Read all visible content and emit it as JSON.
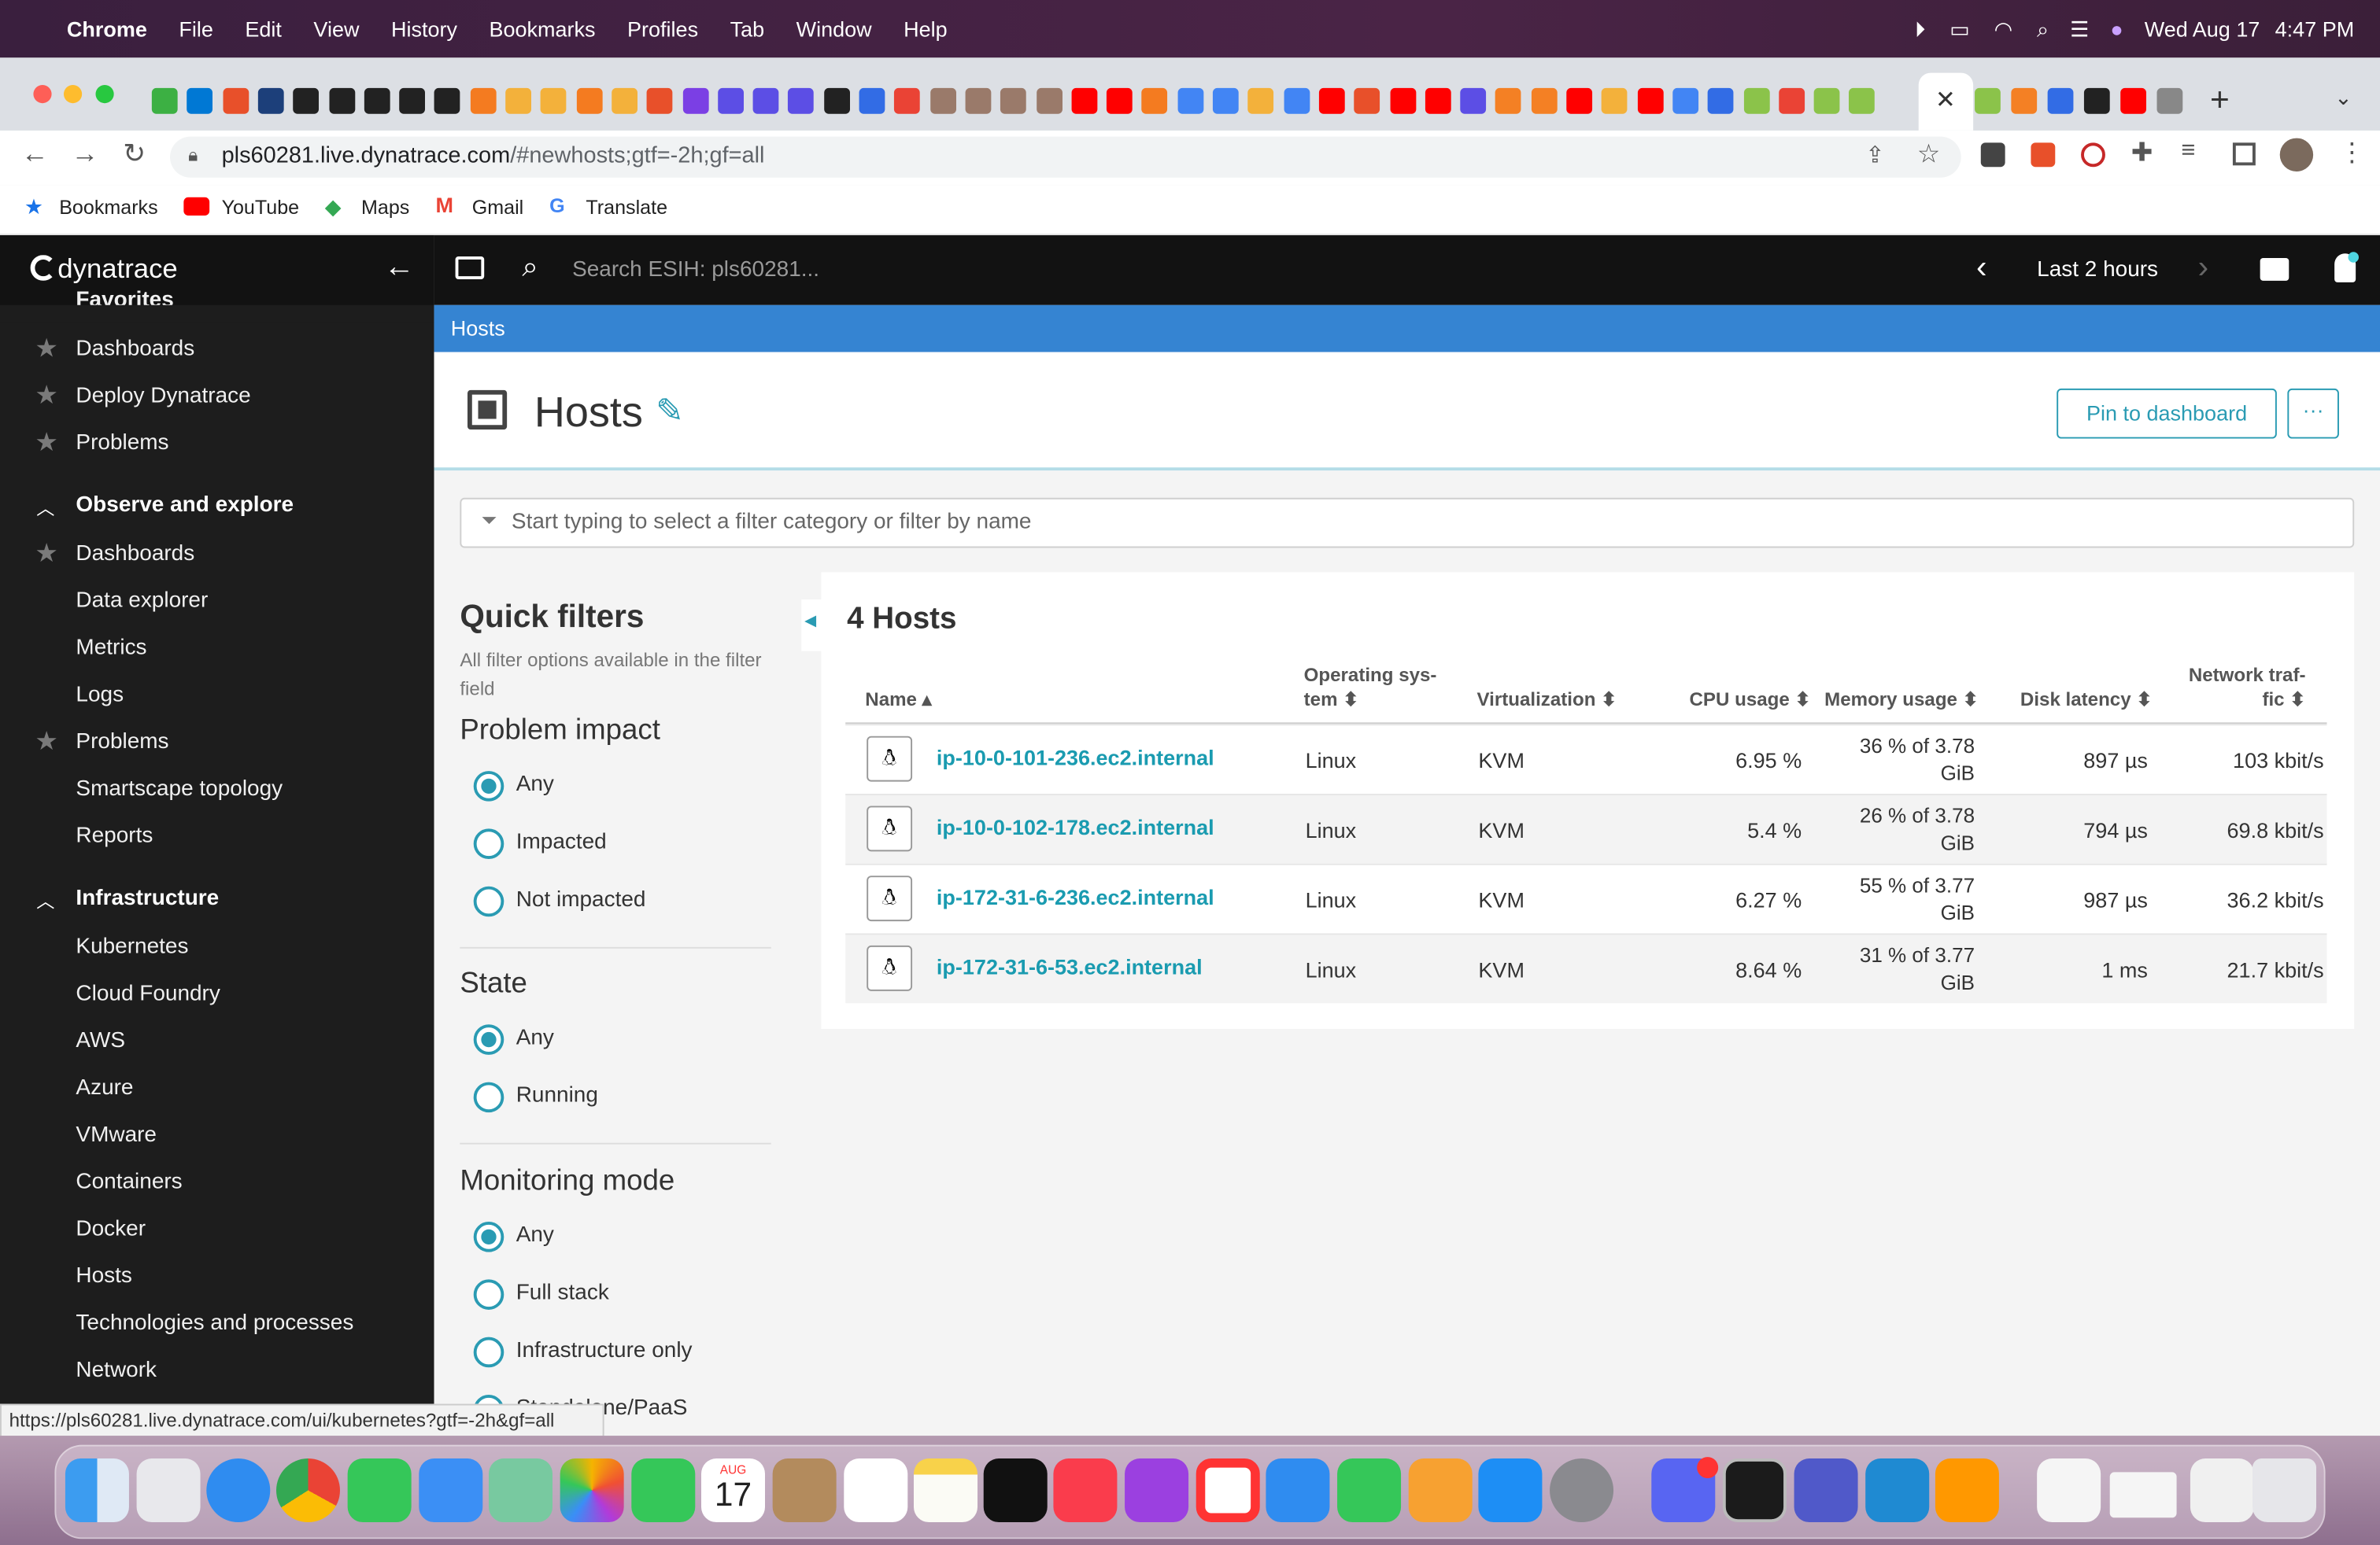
{
  "menubar": {
    "app": "Chrome",
    "items": [
      "File",
      "Edit",
      "View",
      "History",
      "Bookmarks",
      "Profiles",
      "Tab",
      "Window",
      "Help"
    ],
    "date": "Wed Aug 17",
    "time": "4:47 PM"
  },
  "browser": {
    "url_host": "pls60281.live.dynatrace.com",
    "url_path": "/#newhosts;gtf=-2h;gf=all",
    "bookmarks": [
      "Bookmarks",
      "YouTube",
      "Maps",
      "Gmail",
      "Translate"
    ],
    "status_url": "https://pls60281.live.dynatrace.com/ui/kubernetes?gtf=-2h&gf=all"
  },
  "dynatrace": {
    "logo_text": "dynatrace",
    "search_placeholder": "Search ESIH: pls60281...",
    "timeframe": "Last 2 hours",
    "breadcrumb": "Hosts",
    "page_title": "Hosts",
    "pin_label": "Pin to dashboard",
    "more_label": "···",
    "filter_placeholder": "Start typing to select a filter category or filter by name"
  },
  "sidebar": {
    "cut_top": "Favorites",
    "favorites": [
      "Dashboards",
      "Deploy Dynatrace",
      "Problems"
    ],
    "observe_title": "Observe and explore",
    "observe": [
      "Dashboards",
      "Data explorer",
      "Metrics",
      "Logs",
      "Problems",
      "Smartscape topology",
      "Reports"
    ],
    "infra_title": "Infrastructure",
    "infra": [
      "Kubernetes",
      "Cloud Foundry",
      "AWS",
      "Azure",
      "VMware",
      "Containers",
      "Docker",
      "Hosts",
      "Technologies and processes",
      "Network"
    ]
  },
  "quickfilters": {
    "title": "Quick filters",
    "subtitle": "All filter options available in the filter field",
    "problem_title": "Problem impact",
    "problem_options": [
      "Any",
      "Impacted",
      "Not impacted"
    ],
    "state_title": "State",
    "state_options": [
      "Any",
      "Running"
    ],
    "mode_title": "Monitoring mode",
    "mode_options": [
      "Any",
      "Full stack",
      "Infrastructure only",
      "Standalone/PaaS"
    ]
  },
  "hosts_table": {
    "title": "4 Hosts",
    "headers": {
      "name": "Name ▴",
      "os": "Operating sys-\ntem ⬍",
      "virt": "Virtualization ⬍",
      "cpu": "CPU usage ⬍",
      "mem": "Memory usage ⬍",
      "disk": "Disk latency ⬍",
      "net": "Network traf-\nfic ⬍"
    },
    "rows": [
      {
        "name": "ip-10-0-101-236.ec2.internal",
        "os": "Linux",
        "virt": "KVM",
        "cpu": "6.95 %",
        "mem1": "36 % of 3.78",
        "mem2": "GiB",
        "disk": "897 µs",
        "net": "103 kbit/s"
      },
      {
        "name": "ip-10-0-102-178.ec2.internal",
        "os": "Linux",
        "virt": "KVM",
        "cpu": "5.4 %",
        "mem1": "26 % of 3.78",
        "mem2": "GiB",
        "disk": "794 µs",
        "net": "69.8 kbit/s"
      },
      {
        "name": "ip-172-31-6-236.ec2.internal",
        "os": "Linux",
        "virt": "KVM",
        "cpu": "6.27 %",
        "mem1": "55 % of 3.77",
        "mem2": "GiB",
        "disk": "987 µs",
        "net": "36.2 kbit/s"
      },
      {
        "name": "ip-172-31-6-53.ec2.internal",
        "os": "Linux",
        "virt": "KVM",
        "cpu": "8.64 %",
        "mem1": "31 % of 3.77",
        "mem2": "GiB",
        "disk": "1 ms",
        "net": "21.7 kbit/s"
      }
    ]
  },
  "dock": {
    "calendar_month": "AUG",
    "calendar_day": "17"
  }
}
